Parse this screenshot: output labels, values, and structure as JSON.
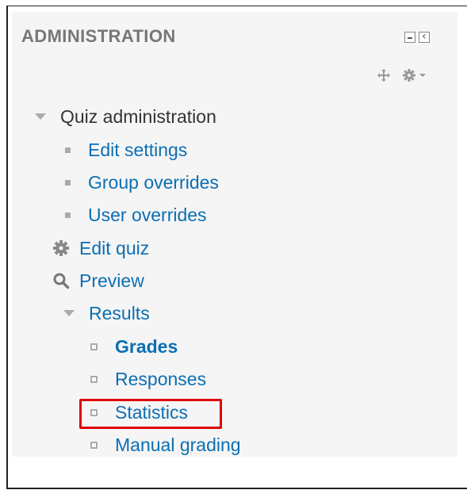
{
  "block": {
    "title": "ADMINISTRATION",
    "controls": {
      "minimize_icon": "minimize-icon",
      "dock_icon": "dock-icon",
      "move_icon": "move-icon",
      "actions_icon": "gear-icon"
    }
  },
  "tree": {
    "quiz_admin": {
      "label": "Quiz administration",
      "expanded": true
    },
    "edit_settings": {
      "label": "Edit settings"
    },
    "group_overrides": {
      "label": "Group overrides"
    },
    "user_overrides": {
      "label": "User overrides"
    },
    "edit_quiz": {
      "label": "Edit quiz",
      "icon": "gear-icon"
    },
    "preview": {
      "label": "Preview",
      "icon": "search-icon"
    },
    "results": {
      "label": "Results",
      "expanded": true,
      "items": {
        "grades": {
          "label": "Grades",
          "active": true
        },
        "responses": {
          "label": "Responses"
        },
        "statistics": {
          "label": "Statistics",
          "highlighted": true
        },
        "manual_grading": {
          "label": "Manual grading"
        }
      }
    }
  },
  "colors": {
    "link": "#0b6fb3",
    "text": "#333333",
    "title": "#777777",
    "highlight": "#e00000",
    "block_bg": "#f5f5f5"
  }
}
